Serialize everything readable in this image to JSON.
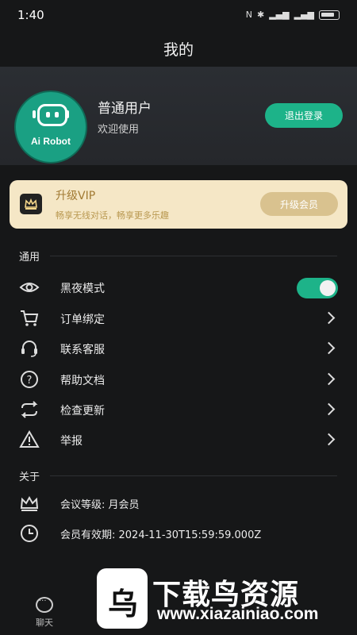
{
  "status_bar": {
    "time": "1:40"
  },
  "header": {
    "title": "我的"
  },
  "profile": {
    "avatar_brand": "Ai Robot",
    "username": "普通用户",
    "subtitle": "欢迎使用",
    "logout_label": "退出登录"
  },
  "vip_banner": {
    "title": "升级VIP",
    "subtitle": "畅享无线对话，畅享更多乐趣",
    "button_label": "升级会员"
  },
  "general": {
    "section_label": "通用",
    "items": [
      {
        "label": "黑夜模式",
        "icon": "eye-icon",
        "toggle_on": true
      },
      {
        "label": "订单绑定",
        "icon": "cart-icon"
      },
      {
        "label": "联系客服",
        "icon": "headset-icon"
      },
      {
        "label": "帮助文档",
        "icon": "help-icon"
      },
      {
        "label": "检查更新",
        "icon": "refresh-icon"
      },
      {
        "label": "举报",
        "icon": "warning-icon"
      }
    ]
  },
  "about": {
    "section_label": "关于",
    "membership_level": "会议等级:  月会员",
    "membership_expiry": "会员有效期:  2024-11-30T15:59:59.000Z"
  },
  "tabbar": {
    "tabs": [
      {
        "label": "聊天"
      }
    ]
  },
  "watermark": {
    "text": "下载鸟资源",
    "url": "www.xiazainiao.com"
  },
  "colors": {
    "accent": "#1db389",
    "vip_bg": "#f5e7c6",
    "background": "#161718"
  }
}
